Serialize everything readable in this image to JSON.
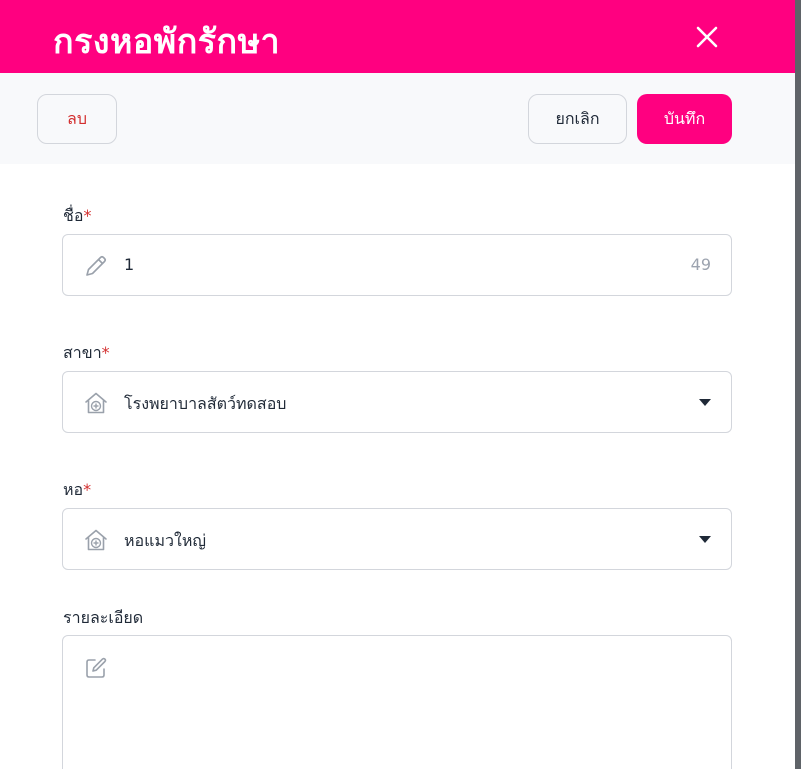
{
  "theme": {
    "accent": "#ff0080",
    "danger": "#d32f2f"
  },
  "header": {
    "title": "กรงหอพักรักษา",
    "close_icon": "close-icon"
  },
  "toolbar": {
    "delete_label": "ลบ",
    "cancel_label": "ยกเลิก",
    "save_label": "บันทึก"
  },
  "form": {
    "name": {
      "label": "ชื่อ",
      "required_mark": "*",
      "value": "1",
      "counter": "49",
      "icon": "pencil-icon"
    },
    "branch": {
      "label": "สาขา",
      "required_mark": "*",
      "value": "โรงพยาบาลสัตว์ทดสอบ",
      "icon": "house-medical-icon"
    },
    "ward": {
      "label": "หอ",
      "required_mark": "*",
      "value": "หอแมวใหญ่",
      "icon": "house-medical-icon"
    },
    "details": {
      "label": "รายละเอียด",
      "value": "",
      "icon": "edit-note-icon"
    }
  }
}
